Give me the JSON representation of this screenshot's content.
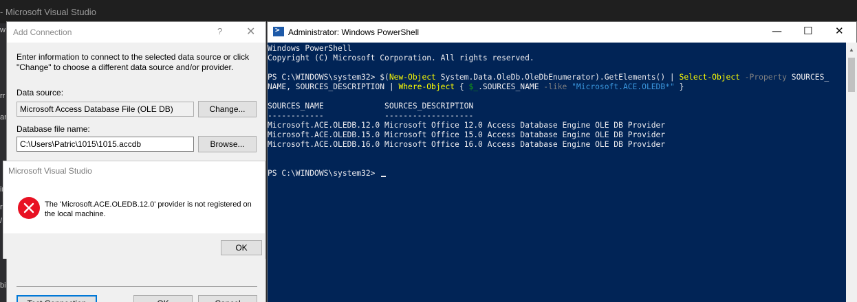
{
  "vs": {
    "title": "- Microsoft Visual Studio",
    "edge_fragments": [
      "w",
      "rr",
      "ar",
      "iri",
      "r",
      "/",
      "bi"
    ]
  },
  "add_connection": {
    "title": "Add Connection",
    "help_glyph": "?",
    "close_glyph": "✕",
    "intro": "Enter information to connect to the selected data source or click \"Change\" to choose a different data source and/or provider.",
    "data_source_label": "Data source:",
    "data_source_value": "Microsoft Access Database File (OLE DB)",
    "change_button": "Change...",
    "db_file_label": "Database file name:",
    "db_file_value": "C:\\Users\\Patric\\1015\\1015.accdb",
    "browse_button": "Browse...",
    "test_button": "Test Connection",
    "ok_button": "OK",
    "cancel_button": "Cancel"
  },
  "error_box": {
    "title": "Microsoft Visual Studio",
    "icon": "error-icon",
    "message": "The 'Microsoft.ACE.OLEDB.12.0' provider is not registered on the local machine.",
    "ok_button": "OK",
    "icon_color": "#e81123"
  },
  "powershell": {
    "title": "Administrator: Windows PowerShell",
    "minimize_glyph": "—",
    "maximize_glyph": "☐",
    "close_glyph": "✕",
    "background_color": "#012456",
    "lines": {
      "l1": "Windows PowerShell",
      "l2": "Copyright (C) Microsoft Corporation. All rights reserved.",
      "cmd_prompt": "PS C:\\WINDOWS\\system32> ",
      "cmd_p1": "$(",
      "cmd_new_object": "New-Object",
      "cmd_p2": " System.Data.OleDb.OleDbEnumerator).GetElements() | ",
      "cmd_select": "Select-Object",
      "cmd_param": " -Property",
      "cmd_p3": " SOURCES_",
      "cmd2_p1": "NAME, SOURCES_DESCRIPTION | ",
      "cmd2_where": "Where-Object",
      "cmd2_p2": " { ",
      "cmd2_var": "$_",
      "cmd2_p3": ".SOURCES_NAME ",
      "cmd2_like": "-like",
      "cmd2_p4": " ",
      "cmd2_str": "\"Microsoft.ACE.OLEDB*\"",
      "cmd2_p5": " }",
      "hdr": "SOURCES_NAME             SOURCES_DESCRIPTION",
      "rule": "------------             -------------------",
      "r1": "Microsoft.ACE.OLEDB.12.0 Microsoft Office 12.0 Access Database Engine OLE DB Provider",
      "r2": "Microsoft.ACE.OLEDB.15.0 Microsoft Office 15.0 Access Database Engine OLE DB Provider",
      "r3": "Microsoft.ACE.OLEDB.16.0 Microsoft Office 16.0 Access Database Engine OLE DB Provider",
      "final_prompt": "PS C:\\WINDOWS\\system32> "
    }
  }
}
